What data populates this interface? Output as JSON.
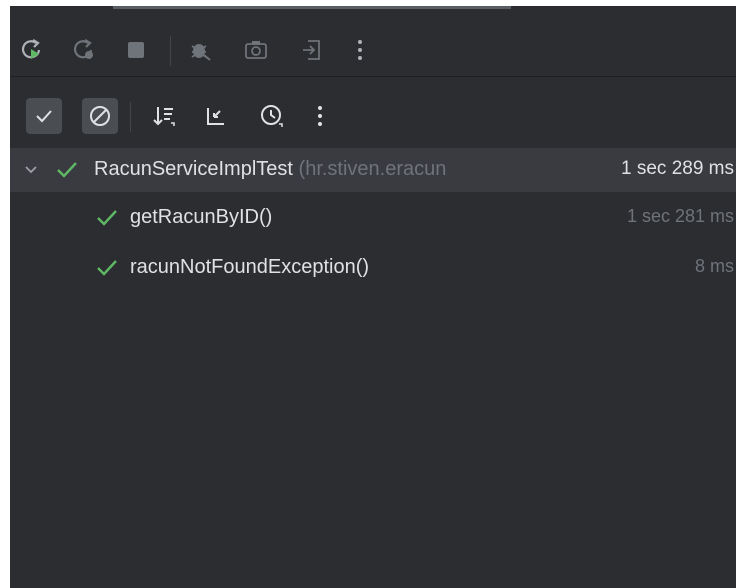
{
  "toolbar_top": {
    "buttons": [
      "rerun-icon",
      "rerun-failed-icon",
      "stop-icon",
      "debug-icon",
      "screenshot-icon",
      "export-icon",
      "more-vert-icon"
    ]
  },
  "toolbar_filter": {
    "buttons": [
      "show-passed-icon",
      "show-ignored-icon",
      "sort-icon",
      "collapse-icon",
      "history-icon",
      "more-vert-icon"
    ]
  },
  "tests": {
    "root": {
      "name": "RacunServiceImplTest",
      "package": "(hr.stiven.eracun",
      "duration": "1 sec 289 ms"
    },
    "children": [
      {
        "name": "getRacunByID()",
        "duration": "1 sec 281 ms"
      },
      {
        "name": "racunNotFoundException()",
        "duration": "8 ms"
      }
    ]
  },
  "colors": {
    "panel_bg": "#2b2d30",
    "pass_green": "#5fb865",
    "text": "#dfe1e5",
    "muted": "#6f737a"
  }
}
